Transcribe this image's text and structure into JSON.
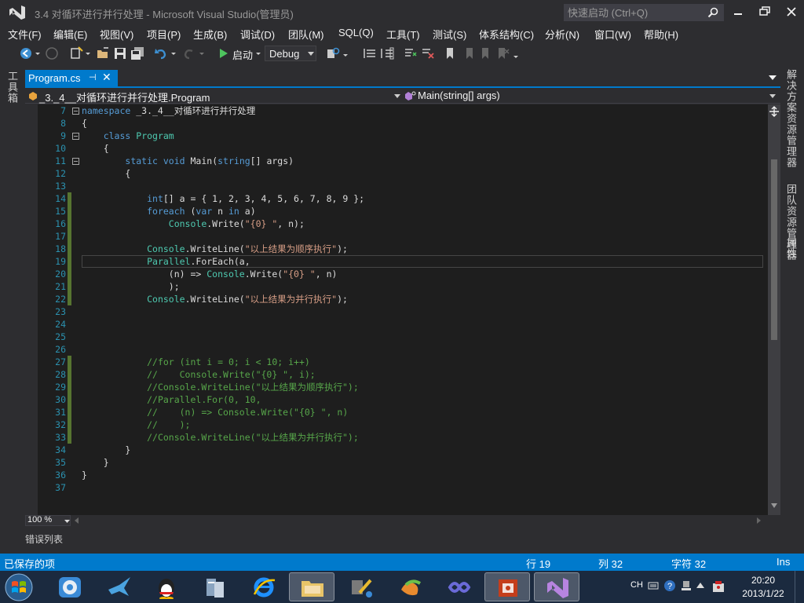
{
  "window": {
    "title": "3.4  对循环进行并行处理 - Microsoft Visual Studio(管理员)",
    "quick_launch_placeholder": "快速启动 (Ctrl+Q)"
  },
  "menu": [
    "文件(F)",
    "编辑(E)",
    "视图(V)",
    "项目(P)",
    "生成(B)",
    "调试(D)",
    "团队(M)",
    "SQL(Q)",
    "工具(T)",
    "测试(S)",
    "体系结构(C)",
    "分析(N)",
    "窗口(W)",
    "帮助(H)"
  ],
  "toolbar": {
    "start_label": "启动",
    "configuration": "Debug"
  },
  "left_panel": {
    "toolbox_label": "工具箱"
  },
  "right_panel": {
    "labels": [
      "解决方案资源管理器",
      "团队资源管理器",
      "属性"
    ]
  },
  "document_tab": {
    "label": "Program.cs",
    "pin_icon": "pin-icon",
    "close_icon": "close-icon"
  },
  "navigation": {
    "type_scope": "_3._4__对循环进行并行处理.Program",
    "member_scope": "Main(string[] args)"
  },
  "code_lines": [
    {
      "n": "7",
      "fold": true,
      "changed": false
    },
    {
      "n": "8",
      "fold": false,
      "changed": false
    },
    {
      "n": "9",
      "fold": true,
      "changed": false
    },
    {
      "n": "10",
      "fold": false,
      "changed": false
    },
    {
      "n": "11",
      "fold": true,
      "changed": false
    },
    {
      "n": "12",
      "fold": false,
      "changed": false
    },
    {
      "n": "13",
      "fold": false,
      "changed": false
    },
    {
      "n": "14",
      "fold": false,
      "changed": true
    },
    {
      "n": "15",
      "fold": false,
      "changed": true
    },
    {
      "n": "16",
      "fold": false,
      "changed": true
    },
    {
      "n": "17",
      "fold": false,
      "changed": true
    },
    {
      "n": "18",
      "fold": false,
      "changed": true
    },
    {
      "n": "19",
      "fold": false,
      "changed": true
    },
    {
      "n": "20",
      "fold": false,
      "changed": true
    },
    {
      "n": "21",
      "fold": false,
      "changed": true
    },
    {
      "n": "22",
      "fold": false,
      "changed": true
    },
    {
      "n": "23",
      "fold": false,
      "changed": false
    },
    {
      "n": "24",
      "fold": false,
      "changed": false
    },
    {
      "n": "25",
      "fold": false,
      "changed": false
    },
    {
      "n": "26",
      "fold": false,
      "changed": false
    },
    {
      "n": "27",
      "fold": false,
      "changed": true
    },
    {
      "n": "28",
      "fold": false,
      "changed": true
    },
    {
      "n": "29",
      "fold": false,
      "changed": true
    },
    {
      "n": "30",
      "fold": false,
      "changed": true
    },
    {
      "n": "31",
      "fold": false,
      "changed": true
    },
    {
      "n": "32",
      "fold": false,
      "changed": true
    },
    {
      "n": "33",
      "fold": false,
      "changed": true
    },
    {
      "n": "34",
      "fold": false,
      "changed": false
    },
    {
      "n": "35",
      "fold": false,
      "changed": false
    },
    {
      "n": "36",
      "fold": false,
      "changed": false
    },
    {
      "n": "37",
      "fold": false,
      "changed": false
    }
  ],
  "code_text": {
    "l7_kw": "namespace",
    "l7_rest": " _3._4__对循环进行并行处理",
    "l8": "{",
    "l9_kw": "class",
    "l9_ty": "Program",
    "l10": "{",
    "l11_kw1": "static",
    "l11_kw2": "void",
    "l11_a": " Main(",
    "l11_kw3": "string",
    "l11_b": "[] args)",
    "l12": "{",
    "l14_kw": "int",
    "l14_rest": "[] a = { 1, 2, 3, 4, 5, 6, 7, 8, 9 };",
    "l15_kw1": "foreach",
    "l15_a": " (",
    "l15_kw2": "var",
    "l15_b": " n ",
    "l15_kw3": "in",
    "l15_c": " a)",
    "l16_ty": "Console",
    "l16_a": ".Write(",
    "l16_st": "\"{0} \"",
    "l16_b": ", n);",
    "l18_ty": "Console",
    "l18_a": ".WriteLine(",
    "l18_st": "\"以上结果为顺序执行\"",
    "l18_b": ");",
    "l19_ty": "Parallel",
    "l19_a": ".ForEach(a,",
    "l20_a": "(n) => ",
    "l20_ty": "Console",
    "l20_b": ".Write(",
    "l20_st": "\"{0} \"",
    "l20_c": ", n)",
    "l21": ");",
    "l22_ty": "Console",
    "l22_a": ".WriteLine(",
    "l22_st": "\"以上结果为并行执行\"",
    "l22_b": ");",
    "l27": "//for (int i = 0; i < 10; i++)",
    "l28": "//    Console.Write(\"{0} \", i);",
    "l29": "//Console.WriteLine(\"以上结果为顺序执行\");",
    "l30": "//Parallel.For(0, 10,",
    "l31": "//    (n) => Console.Write(\"{0} \", n)",
    "l32": "//    );",
    "l33": "//Console.WriteLine(\"以上结果为并行执行\");",
    "l34": "}",
    "l35": "}",
    "l36": "}"
  },
  "editor_footer": {
    "zoom": "100 %"
  },
  "bottom_panel": {
    "error_list_label": "错误列表"
  },
  "status": {
    "message": "已保存的项",
    "line": "行 19",
    "column": "列 32",
    "char": "字符 32",
    "mode": "Ins"
  },
  "taskbar": {
    "apps": [
      "start",
      "media-player",
      "swift-bird-app",
      "qq",
      "server-manager",
      "internet-explorer",
      "file-explorer",
      "tools-app",
      "office-app",
      "vs-link-app",
      "powerpoint",
      "visual-studio"
    ],
    "tray_lang": "CH",
    "time": "20:20",
    "date": "2013/1/22"
  },
  "colors": {
    "accent": "#007acc",
    "editor_bg": "#1e1e1e",
    "keyword": "#569cd6",
    "type": "#4ec9b0",
    "string": "#d69d85",
    "comment": "#57a64a",
    "line_number": "#2b91af"
  }
}
